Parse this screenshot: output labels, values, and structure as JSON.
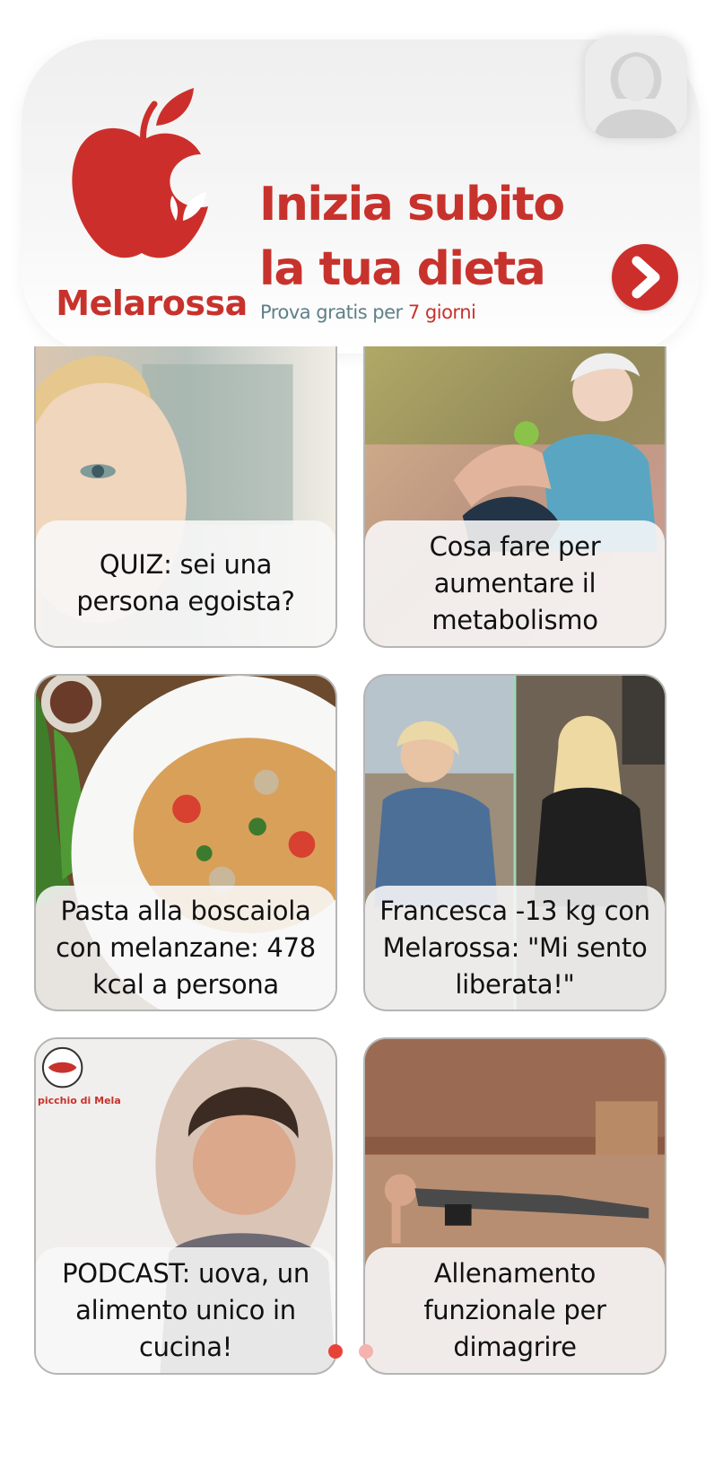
{
  "banner": {
    "brand": "Melarossa",
    "headline_line1": "Inizia subito",
    "headline_line2": "la tua dieta",
    "trial_prefix": "Prova gratis per",
    "trial_highlight": "7 giorni",
    "colors": {
      "brand_red": "#c8322c",
      "trial_gray": "#5f8088"
    },
    "icons": {
      "logo": "apple-logo",
      "cta": "chevron-right-icon",
      "profile": "user-silhouette-icon"
    }
  },
  "cards": [
    {
      "title": "QUIZ: sei una persona egoista?"
    },
    {
      "title": "Cosa fare per aumentare il metabolismo"
    },
    {
      "title": "Pasta alla boscaiola con melanzane: 478 kcal a persona"
    },
    {
      "title": "Francesca -13 kg con Melarossa: \"Mi sento liberata!\""
    },
    {
      "title": "PODCAST: uova, un alimento unico in cucina!",
      "badge": "picchio di Mela"
    },
    {
      "title": "Allenamento funzionale per dimagrire"
    }
  ],
  "pagination": {
    "total": 2,
    "active": 1
  }
}
